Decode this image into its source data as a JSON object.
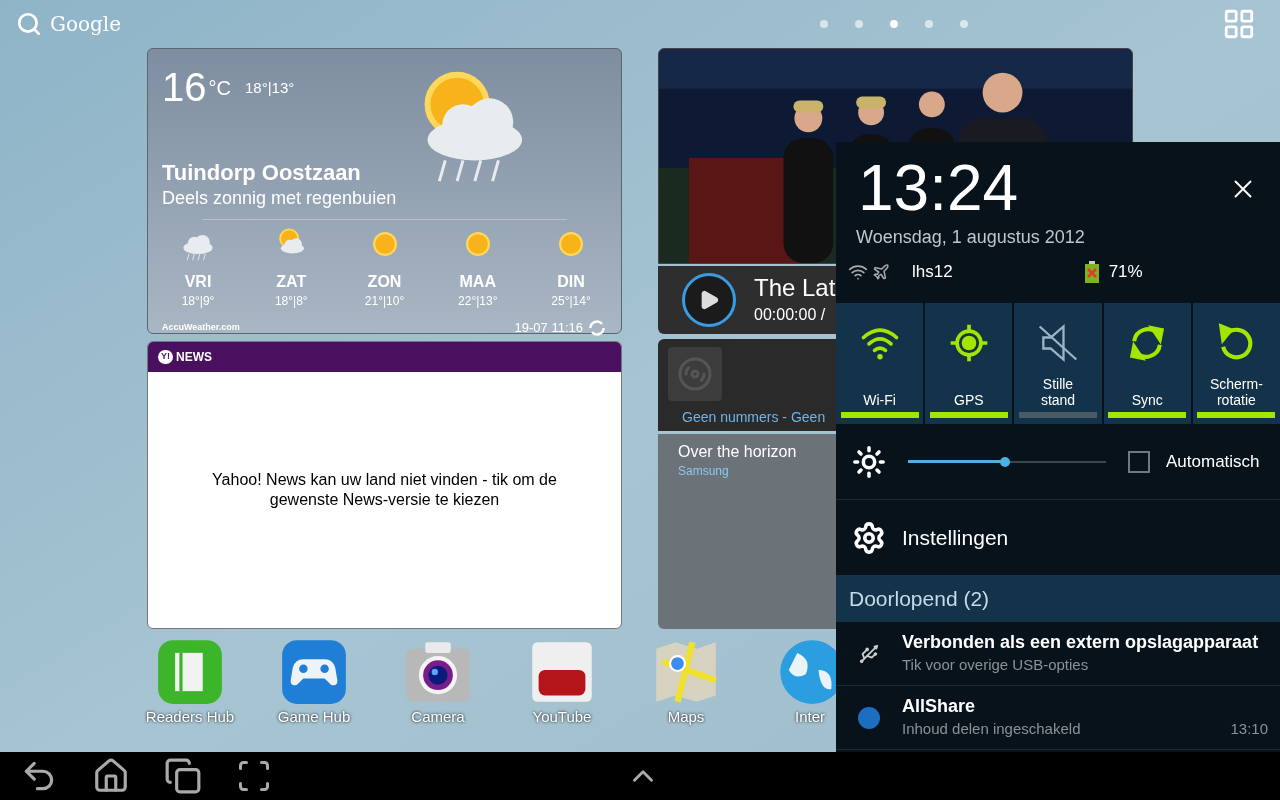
{
  "search": {
    "label": "Google"
  },
  "page_dots": [
    {
      "selected": false
    },
    {
      "selected": false
    },
    {
      "selected": true
    },
    {
      "selected": false
    },
    {
      "selected": false
    }
  ],
  "weather": {
    "temp": "16",
    "unit": "°C",
    "high_low": "18°|13°",
    "city": "Tuindorp Oostzaan",
    "condition": "Deels zonnig met regenbuien",
    "forecast": [
      {
        "day": "VRI",
        "temps": "18°|9°",
        "kind": "rain"
      },
      {
        "day": "ZAT",
        "temps": "18°|8°",
        "kind": "partly"
      },
      {
        "day": "ZON",
        "temps": "21°|10°",
        "kind": "sun"
      },
      {
        "day": "MAA",
        "temps": "22°|13°",
        "kind": "sun"
      },
      {
        "day": "DIN",
        "temps": "25°|14°",
        "kind": "sun"
      }
    ],
    "provider": "AccuWeather.com",
    "updated": "19-07 11:16"
  },
  "news": {
    "badge": "Y!",
    "title": "NEWS",
    "message": "Yahoo! News kan uw land niet vinden - tik om de gewenste News-versie te kiezen"
  },
  "video": {
    "title": "The Lat",
    "time": "00:00:00 /"
  },
  "music": {
    "info": "Geen nummers - Geen"
  },
  "song": {
    "title": "Over the horizon",
    "artist": "Samsung"
  },
  "apps": [
    {
      "label": "Readers Hub",
      "kind": "readers"
    },
    {
      "label": "Game Hub",
      "kind": "game"
    },
    {
      "label": "Camera",
      "kind": "camera"
    },
    {
      "label": "YouTube",
      "kind": "youtube"
    },
    {
      "label": "Maps",
      "kind": "maps"
    },
    {
      "label": "Inter",
      "kind": "globe"
    }
  ],
  "panel": {
    "time": "13:24",
    "date": "Woensdag, 1 augustus 2012",
    "network": "lhs12",
    "battery": "71%",
    "toggles": [
      {
        "label": "Wi-Fi",
        "kind": "wifi",
        "on": true
      },
      {
        "label": "GPS",
        "kind": "gps",
        "on": true
      },
      {
        "label": "Stille stand",
        "kind": "mute",
        "on": false
      },
      {
        "label": "Sync",
        "kind": "sync",
        "on": true
      },
      {
        "label": "Scherm-rotatie",
        "kind": "rotate",
        "on": true
      }
    ],
    "brightness": {
      "level": 0.49,
      "auto_label": "Automatisch",
      "auto_checked": false
    },
    "settings": "Instellingen",
    "section": "Doorlopend (2)",
    "notifications": [
      {
        "kind": "usb",
        "title": "Verbonden als een extern opslagapparaat",
        "text": "Tik voor overige USB-opties"
      },
      {
        "kind": "allshare",
        "title": "AllShare",
        "text": "Inhoud delen ingeschakeld",
        "time": "13:10"
      }
    ]
  }
}
